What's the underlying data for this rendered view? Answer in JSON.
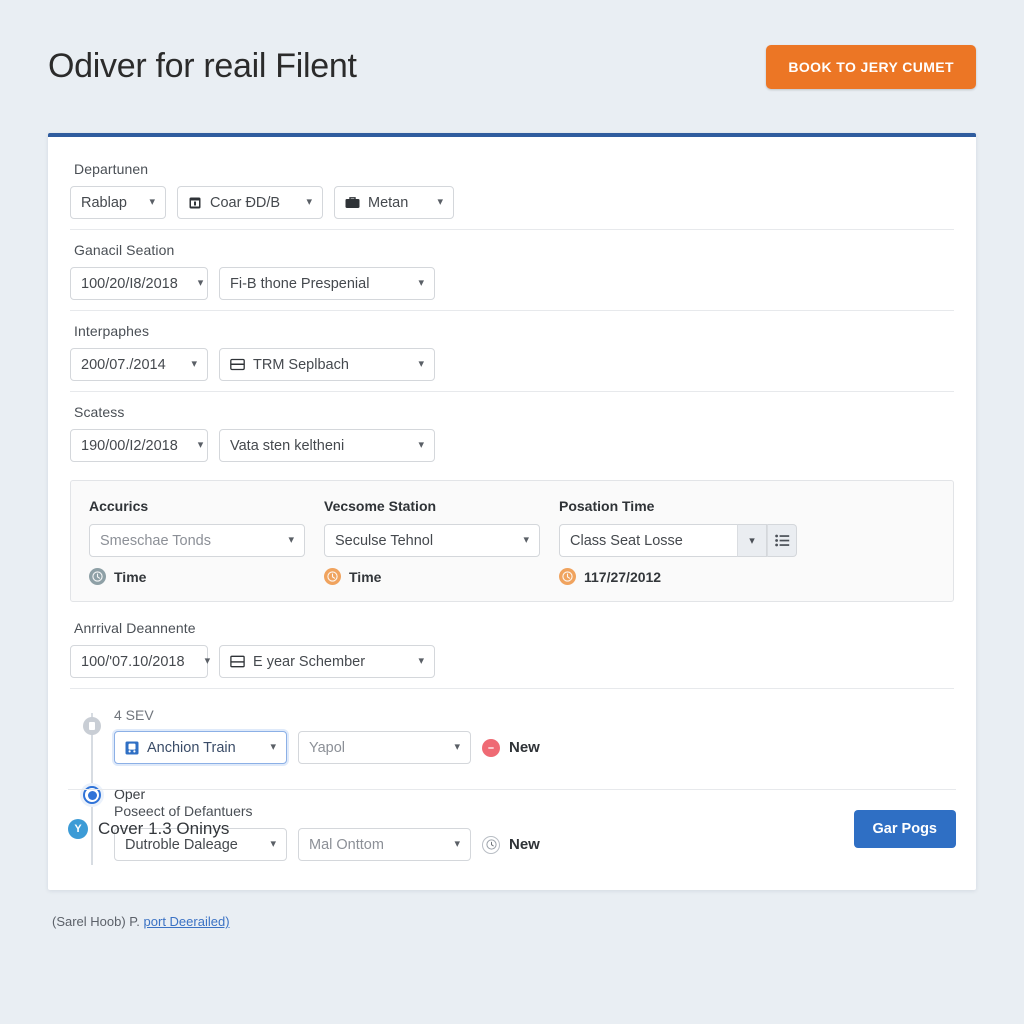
{
  "header": {
    "title": "Odiver for reail Filent",
    "cta_label": "BOOK TO JERY CUMET",
    "accent_color": "#ec7625",
    "card_top_border_color": "#2f5c9e"
  },
  "groups": [
    {
      "label": "Departunen",
      "fields": [
        {
          "value": "Rablap",
          "icon": "none"
        },
        {
          "value": "Coar ÐD/B",
          "icon": "calendar-icon"
        },
        {
          "value": "Metan",
          "icon": "briefcase-icon"
        }
      ]
    },
    {
      "label": "Ganacil Seation",
      "fields": [
        {
          "value": "100/20/I8/2018",
          "icon": "none"
        },
        {
          "value": "Fi-B thone Prespenial",
          "icon": "none"
        }
      ]
    },
    {
      "label": "Interpaphes",
      "fields": [
        {
          "value": "200/07./2014",
          "icon": "none"
        },
        {
          "value": "TRM Seplbach",
          "icon": "card-icon"
        }
      ]
    },
    {
      "label": "Scatess",
      "fields": [
        {
          "value": "190/00/I2/2018",
          "icon": "none"
        },
        {
          "value": "Vata sten keltheni",
          "icon": "none"
        }
      ]
    }
  ],
  "panel": {
    "columns": [
      {
        "title": "Accurics",
        "select_value": "Smeschae Tonds",
        "sub_label": "Time",
        "sub_icon": "clock-icon",
        "sub_icon_color": "#8ea0a6"
      },
      {
        "title": "Vecsome Station",
        "select_value": "Seculse Tehnol",
        "sub_label": "Time",
        "sub_icon": "clock-icon",
        "sub_icon_color": "#f0a35e"
      },
      {
        "title": "Posation Time",
        "select_value": "Class Seat Losse",
        "sub_label": "117/27/2012",
        "sub_icon": "clock-icon",
        "sub_icon_color": "#f0a35e",
        "list_button_icon": "list-icon"
      }
    ]
  },
  "arrival": {
    "label": "Anrrival Deannente",
    "date_value": "100/'07.10/2018",
    "select_value": "E year Schember",
    "select_icon": "window-icon"
  },
  "timeline": {
    "first": {
      "label": "4 SEV",
      "select_value": "Anchion Train",
      "select_icon": "train-icon",
      "second_value": "Yapol",
      "new_label": "New",
      "new_icon_color": "#ef6a74"
    },
    "second": {
      "label": "Oper",
      "sub_label": "Poseect of Defantuers",
      "select_value": "Dutroble Daleage",
      "second_value": "Mal Onttom",
      "new_label": "New",
      "new_icon_color": "#ffffff"
    }
  },
  "card_footer": {
    "badge": "Y",
    "text": "Cover 1.3 Oninys",
    "button_label": "Gar Pogs",
    "button_color": "#2f6fc4"
  },
  "page_footer": {
    "prefix": "(Sarel Hoob) P. ",
    "link": "port Deerailed)"
  }
}
